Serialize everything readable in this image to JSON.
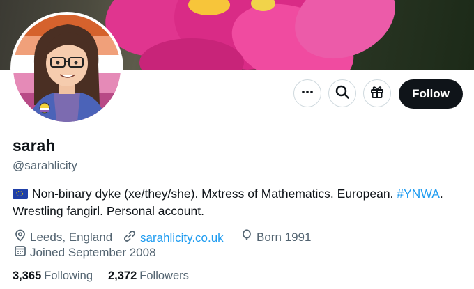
{
  "profile": {
    "display_name": "sarah",
    "handle": "@sarahlicity",
    "bio_flag": "eu-flag",
    "bio_text": "Non-binary dyke (xe/they/she). Mxtress of Mathematics. European. ",
    "bio_hashtag": "#YNWA",
    "bio_text_after": ".",
    "bio_line2": "Wrestling fangirl. Personal account.",
    "location": "Leeds, England",
    "website": "sarahlicity.co.uk",
    "birth": "Born 1991",
    "joined": "Joined September 2008"
  },
  "stats": {
    "following_count": "3,365",
    "following_label": "Following",
    "followers_count": "2,372",
    "followers_label": "Followers"
  },
  "actions": {
    "follow_label": "Follow",
    "more_icon": "more-icon",
    "search_icon": "search-icon",
    "gift_icon": "gift-icon"
  },
  "colors": {
    "accent_link": "#1d9bf0",
    "follow_bg": "#0f1419",
    "muted_text": "#536471"
  }
}
